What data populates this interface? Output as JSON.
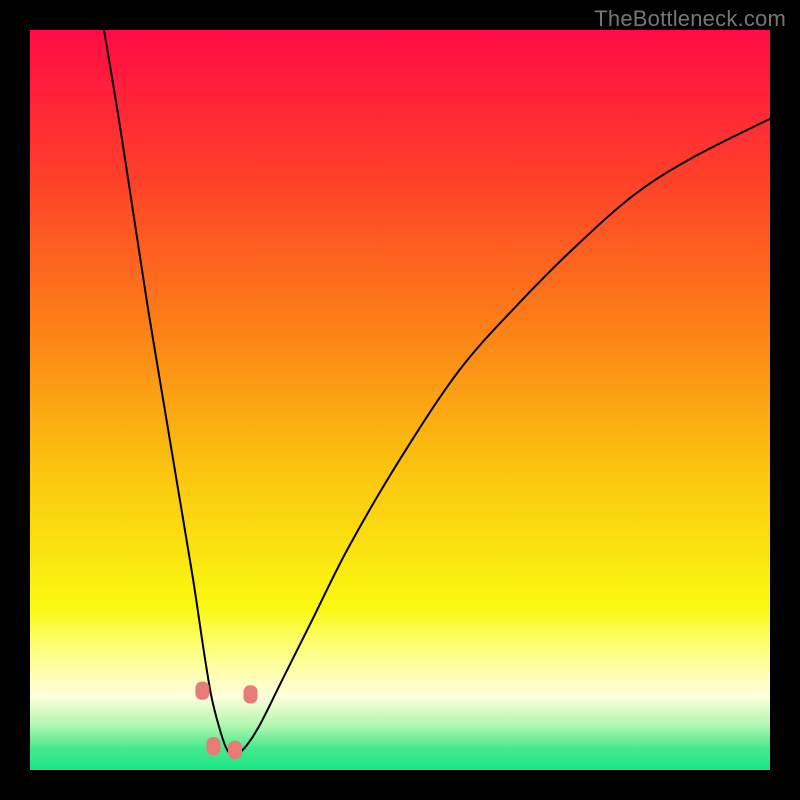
{
  "watermark": "TheBottleneck.com",
  "chart_data": {
    "type": "line",
    "title": "",
    "xlabel": "",
    "ylabel": "",
    "xlim": [
      0,
      100
    ],
    "ylim": [
      0,
      100
    ],
    "background_gradient": {
      "type": "vertical-from-top",
      "stops": [
        {
          "pos": 0.0,
          "color": "#ff0b45"
        },
        {
          "pos": 0.2,
          "color": "#ff4029"
        },
        {
          "pos": 0.4,
          "color": "#fc8017"
        },
        {
          "pos": 0.6,
          "color": "#fbc60f"
        },
        {
          "pos": 0.78,
          "color": "#faf910"
        },
        {
          "pos": 0.84,
          "color": "#fdfe85"
        },
        {
          "pos": 0.9,
          "color": "#fefedc"
        },
        {
          "pos": 0.94,
          "color": "#b0f6af"
        },
        {
          "pos": 0.97,
          "color": "#49e98e"
        },
        {
          "pos": 1.0,
          "color": "#18e686"
        }
      ]
    },
    "series": [
      {
        "name": "bottleneck-curve",
        "stroke": "#000000",
        "stroke_width": 2,
        "x": [
          10,
          12,
          14,
          16,
          18,
          20,
          22,
          23.5,
          24.5,
          25.5,
          26.5,
          27.5,
          29,
          31,
          34,
          38,
          43,
          50,
          58,
          66,
          74,
          82,
          90,
          100
        ],
        "y": [
          100,
          88,
          75,
          62,
          50,
          38,
          26,
          16,
          10,
          6,
          3,
          2,
          3,
          6,
          12,
          20,
          30,
          42,
          54,
          63,
          71,
          78,
          83,
          88
        ]
      }
    ],
    "markers": {
      "shape": "rounded-square",
      "color": "#e77c76",
      "size": 14,
      "points": [
        {
          "x": 23.3,
          "y": 11.0
        },
        {
          "x": 24.8,
          "y": 3.5
        },
        {
          "x": 27.7,
          "y": 3.0
        },
        {
          "x": 29.8,
          "y": 10.5
        }
      ]
    }
  }
}
